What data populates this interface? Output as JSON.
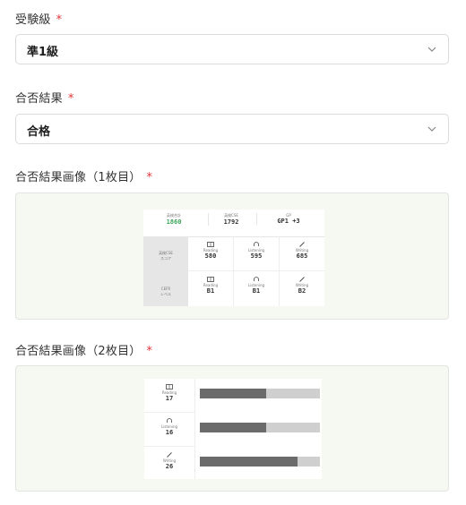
{
  "form": {
    "grade_label": "受験級",
    "grade_value": "準1級",
    "result_label": "合否結果",
    "result_value": "合格",
    "image1_label": "合否結果画像（1枚目）",
    "image2_label": "合否結果画像（2枚目）",
    "required_mark": "*"
  },
  "score_image": {
    "total_score": "1860",
    "cse_score": "1792",
    "gp": "GP1 +3",
    "row1_header": "英検CSE\nスコア",
    "row2_header": "CEFR\nレベル",
    "skills": [
      {
        "icon": "book-icon",
        "name": "Reading",
        "score": "580",
        "cefr": "B1"
      },
      {
        "icon": "headphone-icon",
        "name": "Listening",
        "score": "595",
        "cefr": "B1"
      },
      {
        "icon": "pen-icon",
        "name": "Writing",
        "score": "685",
        "cefr": "B2"
      }
    ]
  },
  "detail_image": {
    "rows": [
      {
        "icon": "book-icon",
        "name": "Reading",
        "score": "17",
        "bar_pct": 0.55
      },
      {
        "icon": "headphone-icon",
        "name": "Listening",
        "score": "16",
        "bar_pct": 0.55
      },
      {
        "icon": "pen-icon",
        "name": "Writing",
        "score": "26",
        "bar_pct": 0.81
      }
    ],
    "bar_labels": [
      "55",
      "55",
      "81"
    ]
  },
  "colors": {
    "required": "#e0353a",
    "score_green": "#3aa55a",
    "bar_fill": "#6b6b6b",
    "bar_bg": "#cfcfcf"
  }
}
